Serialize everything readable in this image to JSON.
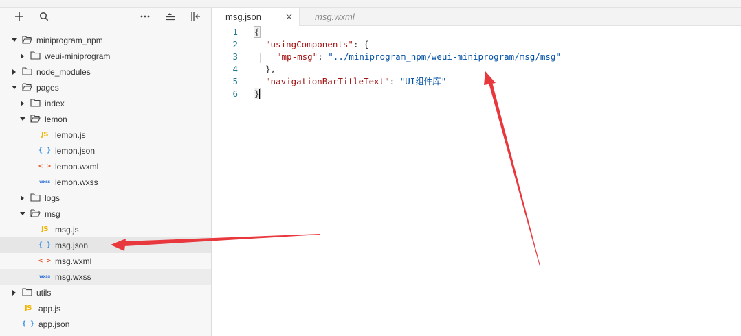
{
  "toolbar": {
    "buttons": [
      {
        "name": "add-icon"
      },
      {
        "name": "search-icon"
      },
      {
        "name": "more-icon"
      },
      {
        "name": "collapse-all-icon"
      },
      {
        "name": "hide-sidebar-icon"
      }
    ]
  },
  "tree": [
    {
      "label": "miniprogram_npm",
      "type": "folder",
      "expanded": true
    },
    {
      "label": "weui-miniprogram",
      "type": "folder",
      "expanded": false
    },
    {
      "label": "node_modules",
      "type": "folder",
      "expanded": false
    },
    {
      "label": "pages",
      "type": "folder",
      "expanded": true
    },
    {
      "label": "index",
      "type": "folder",
      "expanded": false
    },
    {
      "label": "lemon",
      "type": "folder",
      "expanded": true
    },
    {
      "label": "lemon.js",
      "type": "js",
      "icon_text": "JS"
    },
    {
      "label": "lemon.json",
      "type": "json",
      "icon_text": "{ }"
    },
    {
      "label": "lemon.wxml",
      "type": "wxml",
      "icon_text": "< >"
    },
    {
      "label": "lemon.wxss",
      "type": "wxss",
      "icon_text": "wxss"
    },
    {
      "label": "logs",
      "type": "folder",
      "expanded": false
    },
    {
      "label": "msg",
      "type": "folder",
      "expanded": true
    },
    {
      "label": "msg.js",
      "type": "js",
      "icon_text": "JS"
    },
    {
      "label": "msg.json",
      "type": "json",
      "icon_text": "{ }",
      "selected": true
    },
    {
      "label": "msg.wxml",
      "type": "wxml",
      "icon_text": "< >"
    },
    {
      "label": "msg.wxss",
      "type": "wxss",
      "icon_text": "wxss",
      "hovered": true
    },
    {
      "label": "utils",
      "type": "folder",
      "expanded": false
    },
    {
      "label": "app.js",
      "type": "js",
      "icon_text": "JS"
    },
    {
      "label": "app.json",
      "type": "json",
      "icon_text": "{ }"
    }
  ],
  "tabs": [
    {
      "label": "msg.json",
      "active": true,
      "close": "✕"
    },
    {
      "label": "msg.wxml",
      "active": false
    }
  ],
  "editor": {
    "line_numbers": [
      "1",
      "2",
      "3",
      "4",
      "5",
      "6"
    ],
    "lines": {
      "l1_open": "{",
      "l2_key": "\"usingComponents\"",
      "l2_rest": ": {",
      "l3_key": "\"mp-msg\"",
      "l3_colon": ": ",
      "l3_val": "\"../miniprogram_npm/weui-miniprogram/msg/msg\"",
      "l4_close": "},",
      "l5_key": "\"navigationBarTitleText\"",
      "l5_colon": ": ",
      "l5_val": "\"UI组件库\"",
      "l6_close": "}"
    }
  },
  "colors": {
    "annotation_arrow": "#e8383d",
    "line_number": "#237893",
    "json_key": "#a31515",
    "json_string": "#0451a5"
  }
}
